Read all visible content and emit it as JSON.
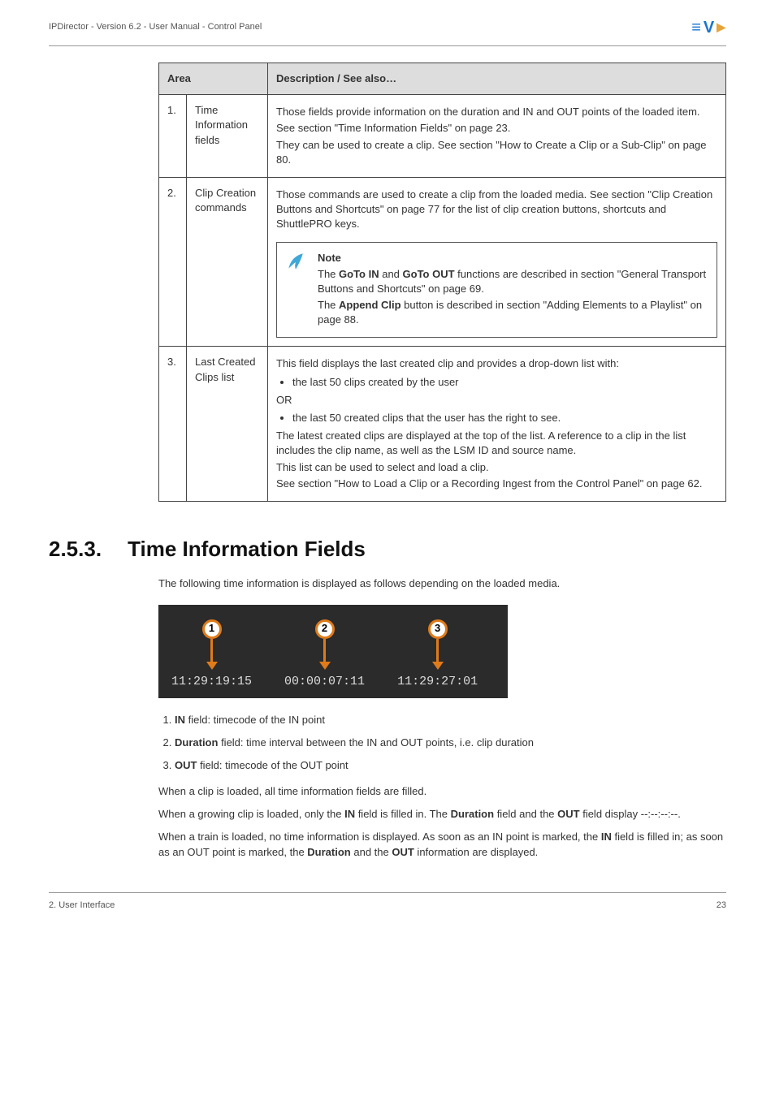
{
  "header": {
    "doc_title": "IPDirector - Version 6.2 - User Manual - Control Panel"
  },
  "table": {
    "col1": "Area",
    "col2": "Description / See also…",
    "rows": [
      {
        "num": "1.",
        "label": "Time Information fields",
        "p1": "Those fields provide information on the duration and IN and OUT points of the loaded item.",
        "p2": "See section \"Time Information Fields\" on page 23.",
        "p3": "They can be used to create a clip. See section \"How to Create a Clip or a Sub-Clip\" on page 80."
      },
      {
        "num": "2.",
        "label": "Clip Creation commands",
        "p1": "Those commands are used to create a clip from the loaded media. See section \"Clip Creation Buttons and Shortcuts\" on page 77 for the list of clip creation buttons, shortcuts and ShuttlePRO keys.",
        "note_title": "Note",
        "note_l1a": "The ",
        "note_l1b": "GoTo IN",
        "note_l1c": " and ",
        "note_l1d": "GoTo OUT",
        "note_l1e": " functions are described in section \"General Transport Buttons and Shortcuts\" on page 69.",
        "note_l2a": "The ",
        "note_l2b": "Append Clip",
        "note_l2c": " button is described in section \"Adding Elements to a Playlist\" on page 88."
      },
      {
        "num": "3.",
        "label": "Last Created Clips list",
        "p1": "This field displays the last created clip and provides a drop-down list with:",
        "li1": "the last 50 clips created by the user",
        "or": "OR",
        "li2": "the last 50 created clips that the user has the right to see.",
        "p2": "The latest created clips are displayed at the top of the list. A reference to a clip in the list includes the clip name, as well as the LSM ID and source name.",
        "p3": "This list can be used to select and load a clip.",
        "p4": "See section \"How to Load a Clip or a Recording Ingest from the Control Panel\" on page 62."
      }
    ]
  },
  "section": {
    "num": "2.5.3.",
    "title": "Time Information Fields",
    "intro": "The following time information is displayed as follows depending on the loaded media."
  },
  "diagram": {
    "c1": "1",
    "c2": "2",
    "c3": "3",
    "t1": "11:29:19:15",
    "t2": "00:00:07:11",
    "t3": "11:29:27:01"
  },
  "list": {
    "i1a": "IN",
    "i1b": " field: timecode of the IN point",
    "i2a": "Duration",
    "i2b": " field: time interval between the IN and OUT points, i.e. clip duration",
    "i3a": "OUT",
    "i3b": " field: timecode of the OUT point"
  },
  "paras": {
    "p1": "When a clip is loaded, all time information fields are filled.",
    "p2a": "When a growing clip is loaded, only the ",
    "p2b": "IN",
    "p2c": " field is filled in. The ",
    "p2d": "Duration",
    "p2e": " field and the ",
    "p2f": "OUT",
    "p2g": " field display --:--:--:--.",
    "p3a": "When a train is loaded, no time information is displayed. As soon as an IN point is marked, the ",
    "p3b": "IN",
    "p3c": " field is filled in; as soon as an OUT point is marked, the ",
    "p3d": "Duration",
    "p3e": " and the ",
    "p3f": "OUT",
    "p3g": " information are displayed."
  },
  "footer": {
    "left": "2. User Interface",
    "right": "23"
  }
}
